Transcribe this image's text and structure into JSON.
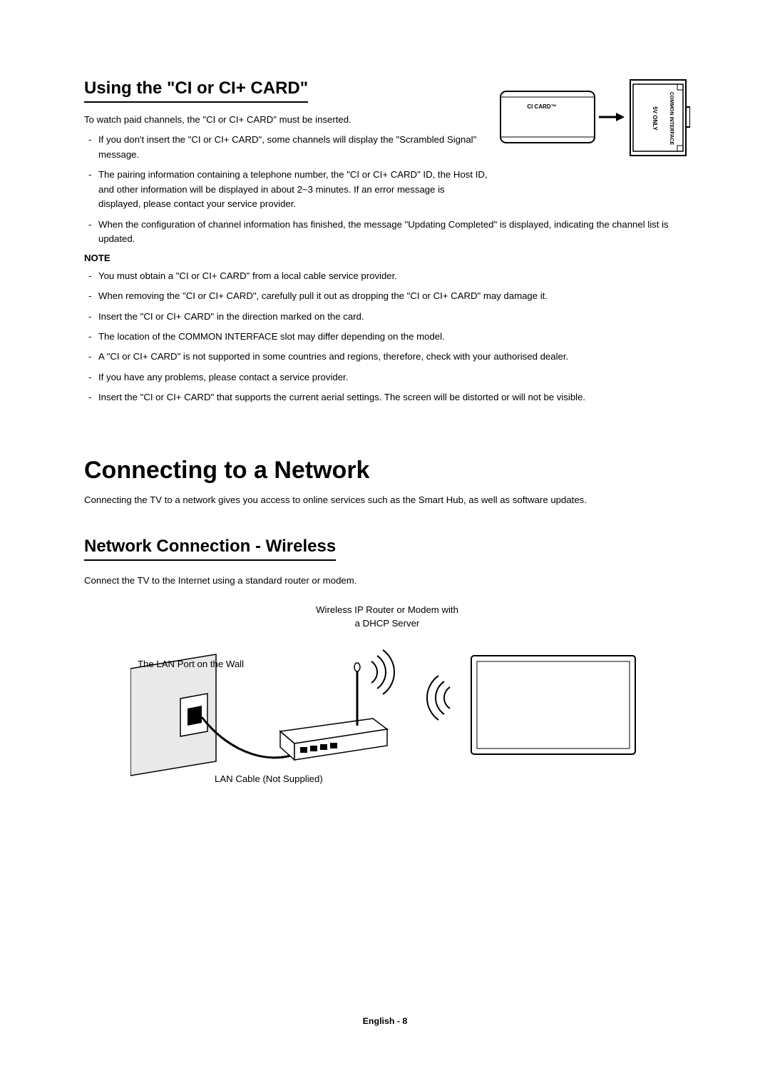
{
  "section1": {
    "title": "Using the \"CI or CI+ CARD\"",
    "intro": "To watch paid channels, the \"CI or CI+ CARD\" must be inserted.",
    "bullets": [
      "If you don't insert the \"CI or CI+ CARD\", some channels will display the \"Scrambled Signal\" message.",
      "The pairing information containing a telephone number, the \"CI or CI+ CARD\" ID, the Host ID, and other information will be displayed in about 2~3 minutes. If an error message is displayed, please contact your service provider.",
      "When the configuration of channel information has finished, the message \"Updating Completed\" is displayed, indicating the channel list is updated."
    ],
    "noteLabel": "NOTE",
    "notes": [
      "You must obtain a \"CI or CI+ CARD\" from a local cable service provider.",
      "When removing the \"CI or CI+ CARD\", carefully pull it out as dropping the \"CI or CI+ CARD\" may damage it.",
      "Insert the \"CI or CI+ CARD\" in the direction marked on the card.",
      "The location of the COMMON INTERFACE slot may differ depending on the model.",
      "A \"CI or CI+ CARD\" is not supported in some countries and regions, therefore, check with your authorised dealer.",
      "If you have any problems, please contact a service provider.",
      "Insert the \"CI or CI+ CARD\" that supports the current aerial settings. The screen will be distorted or will not be visible."
    ],
    "card_label": "CI CARD™",
    "slot_label_1": "5V ONLY",
    "slot_label_2": "COMMON INTERFACE"
  },
  "section2": {
    "heading": "Connecting to a Network",
    "copy": "Connecting the TV to a network gives you access to online services such as the Smart Hub, as well as software updates.",
    "subheading": "Network Connection - Wireless",
    "subcopy": "Connect the TV to the Internet using a standard router or modem.",
    "diagram_top": "Wireless IP Router or Modem with\na DHCP Server",
    "diagram_left": "The LAN Port on the Wall",
    "diagram_bottom": "LAN Cable (Not Supplied)"
  },
  "footer": "English - 8"
}
